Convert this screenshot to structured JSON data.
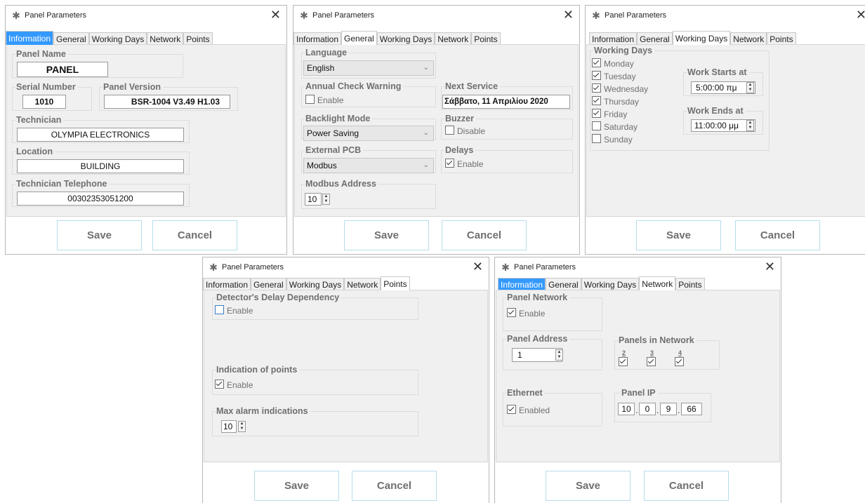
{
  "window_title": "Panel Parameters",
  "tabs": [
    "Information",
    "General",
    "Working Days",
    "Network",
    "Points"
  ],
  "buttons": {
    "save": "Save",
    "cancel": "Cancel"
  },
  "information": {
    "panel_name_label": "Panel Name",
    "panel_name": "PANEL",
    "serial_label": "Serial Number",
    "serial": "1010",
    "version_label": "Panel Version",
    "version": "BSR-1004 V3.49 H1.03",
    "technician_label": "Technician",
    "technician": "OLYMPIA ELECTRONICS",
    "location_label": "Location",
    "location": "BUILDING",
    "telephone_label": "Technician Telephone",
    "telephone": "00302353051200"
  },
  "general": {
    "language_label": "Language",
    "language": "English",
    "annual_label": "Annual Check Warning",
    "annual_cb": "Enable",
    "next_service_label": "Next Service",
    "next_service": "Σάββατο, 11 Απριλίου 2020",
    "backlight_label": "Backlight Mode",
    "backlight": "Power Saving",
    "buzzer_label": "Buzzer",
    "buzzer_cb": "Disable",
    "external_label": "External PCB",
    "external": "Modbus",
    "delays_label": "Delays",
    "delays_cb": "Enable",
    "modbus_label": "Modbus Address",
    "modbus": "10"
  },
  "working_days": {
    "group_label": "Working Days",
    "days": [
      {
        "name": "Monday",
        "checked": true
      },
      {
        "name": "Tuesday",
        "checked": true
      },
      {
        "name": "Wednesday",
        "checked": true
      },
      {
        "name": "Thursday",
        "checked": true
      },
      {
        "name": "Friday",
        "checked": true
      },
      {
        "name": "Saturday",
        "checked": false
      },
      {
        "name": "Sunday",
        "checked": false
      }
    ],
    "starts_label": "Work Starts at",
    "starts": "5:00:00 πμ",
    "ends_label": "Work Ends at",
    "ends": "11:00:00 μμ"
  },
  "points": {
    "delay_label": "Detector's Delay Dependency",
    "delay_cb": "Enable",
    "indication_label": "Indication of points",
    "indication_cb": "Enable",
    "max_label": "Max alarm indications",
    "max": "10"
  },
  "network": {
    "panel_network_label": "Panel Network",
    "panel_network_cb": "Enable",
    "address_label": "Panel Address",
    "address": "1",
    "panels_label": "Panels in Network",
    "panels": [
      "2",
      "3",
      "4"
    ],
    "ethernet_label": "Ethernet",
    "ethernet_cb": "Enabled",
    "ip_label": "Panel IP",
    "ip": [
      "10",
      "0",
      "9",
      "66"
    ]
  },
  "icons": {
    "title": "gear-icon",
    "close": "close-icon",
    "spinner": "spinner-arrows-icon",
    "dropdown": "chevron-down-icon"
  }
}
